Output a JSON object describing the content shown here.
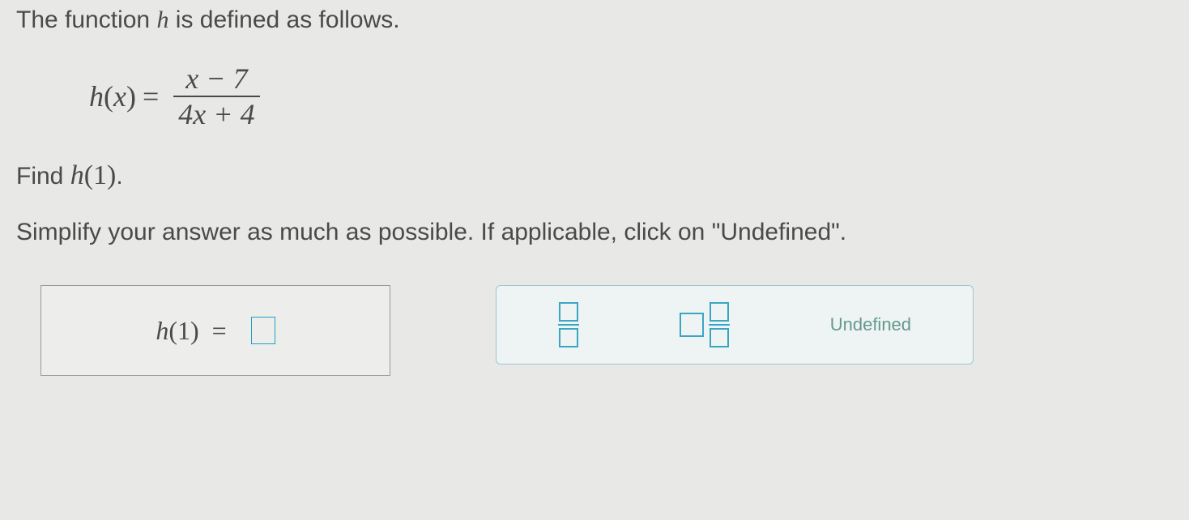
{
  "intro": {
    "prefix": "The function ",
    "var": "h",
    "suffix": " is defined as follows."
  },
  "formula": {
    "lhs_func": "h",
    "lhs_arg": "x",
    "eq": "=",
    "numerator": "x − 7",
    "denominator": "4x + 4"
  },
  "find": {
    "prefix": "Find ",
    "func": "h",
    "arg": "1",
    "suffix": "."
  },
  "simplify": "Simplify your answer as much as possible. If applicable, click on \"Undefined\".",
  "answer": {
    "func": "h",
    "arg": "1",
    "eq": "="
  },
  "palette": {
    "undefined_label": "Undefined"
  }
}
